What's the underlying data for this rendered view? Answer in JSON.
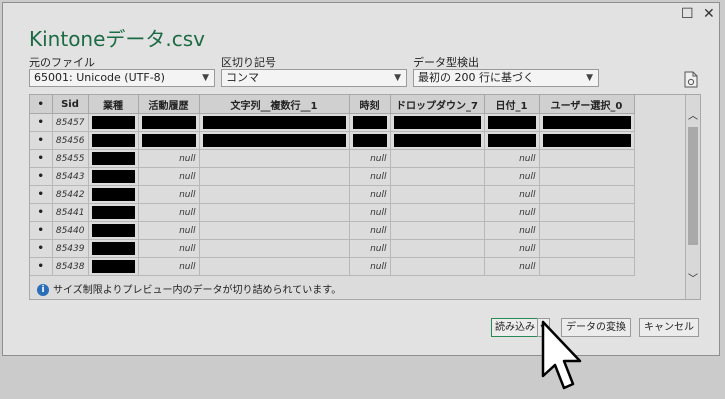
{
  "window": {
    "title": "Kintoneデータ.csv",
    "maximize_glyph": "☐",
    "close_glyph": "✕"
  },
  "controls": {
    "file_origin_label": "元のファイル",
    "file_origin_value": "65001: Unicode (UTF-8)",
    "delimiter_label": "区切り記号",
    "delimiter_value": "コンマ",
    "type_detect_label": "データ型検出",
    "type_detect_value": "最初の 200 行に基づく",
    "icons": {
      "refresh": "file-refresh-icon",
      "dropdown": "chevron-down-icon"
    }
  },
  "table": {
    "columns": [
      "•",
      "Sid",
      "業種",
      "活動履歴",
      "文字列__複数行__1",
      "時刻",
      "ドロップダウン_7",
      "日付_1",
      "ユーザー選択_0"
    ],
    "rows": [
      {
        "dot": "•",
        "sid": "85457",
        "cells": [
          "█",
          "█",
          "█",
          "█",
          "█",
          "█",
          "█"
        ]
      },
      {
        "dot": "•",
        "sid": "85456",
        "cells": [
          "█",
          "█",
          "█",
          "█",
          "█",
          "█",
          "█"
        ]
      },
      {
        "dot": "•",
        "sid": "85455",
        "cells": [
          "█",
          "null",
          "",
          "null",
          "",
          "null",
          ""
        ]
      },
      {
        "dot": "•",
        "sid": "85443",
        "cells": [
          "█",
          "null",
          "",
          "null",
          "",
          "null",
          ""
        ]
      },
      {
        "dot": "•",
        "sid": "85442",
        "cells": [
          "█",
          "null",
          "",
          "null",
          "",
          "null",
          ""
        ]
      },
      {
        "dot": "•",
        "sid": "85441",
        "cells": [
          "█",
          "null",
          "",
          "null",
          "",
          "null",
          ""
        ]
      },
      {
        "dot": "•",
        "sid": "85440",
        "cells": [
          "█",
          "null",
          "",
          "null",
          "",
          "null",
          ""
        ]
      },
      {
        "dot": "•",
        "sid": "85439",
        "cells": [
          "█",
          "null",
          "",
          "null",
          "",
          "null",
          ""
        ]
      },
      {
        "dot": "•",
        "sid": "85438",
        "cells": [
          "█",
          "null",
          "",
          "null",
          "",
          "null",
          ""
        ]
      }
    ]
  },
  "info_message": "サイズ制限よりプレビュー内のデータが切り詰められています。",
  "buttons": {
    "load": "読み込み",
    "transform": "データの変換",
    "cancel": "キャンセル"
  },
  "colors": {
    "accent": "#1d6b45",
    "info": "#2a6fb8"
  }
}
